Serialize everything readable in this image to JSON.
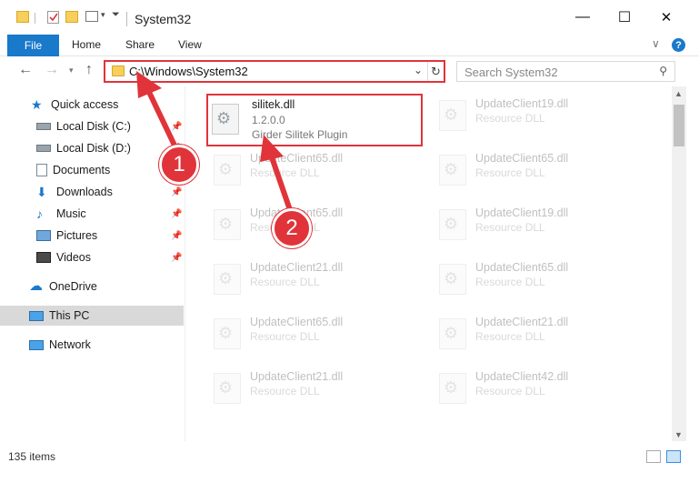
{
  "window": {
    "title": "System32",
    "minimize": "—",
    "maximize": "☐",
    "close": "✕"
  },
  "ribbon": {
    "file_tab": "File",
    "tabs": [
      "Home",
      "Share",
      "View"
    ],
    "help": "?",
    "expand": "∨"
  },
  "address": {
    "path": "C:\\Windows\\System32",
    "search_placeholder": "Search System32"
  },
  "sidebar": {
    "items": [
      {
        "label": "Quick access",
        "icon": "star-icon",
        "pinned": false
      },
      {
        "label": "Local Disk (C:)",
        "icon": "drive-icon",
        "pinned": true
      },
      {
        "label": "Local Disk (D:)",
        "icon": "drive-icon",
        "pinned": true
      },
      {
        "label": "Documents",
        "icon": "documents-icon",
        "pinned": true
      },
      {
        "label": "Downloads",
        "icon": "download-icon",
        "pinned": true
      },
      {
        "label": "Music",
        "icon": "music-icon",
        "pinned": true
      },
      {
        "label": "Pictures",
        "icon": "pictures-icon",
        "pinned": true
      },
      {
        "label": "Videos",
        "icon": "videos-icon",
        "pinned": true
      },
      {
        "label": "OneDrive",
        "icon": "cloud-icon",
        "pinned": false
      },
      {
        "label": "This PC",
        "icon": "computer-icon",
        "pinned": false
      },
      {
        "label": "Network",
        "icon": "network-icon",
        "pinned": false
      }
    ]
  },
  "files": {
    "highlighted": {
      "name": "silitek.dll",
      "version": "1.2.0.0",
      "description": "Girder Silitek Plugin"
    },
    "faded": [
      {
        "name": "UpdateClient19.dll",
        "type": "Resource DLL"
      },
      {
        "name": "UpdateClient65.dll",
        "type": "Resource DLL"
      },
      {
        "name": "UpdateClient65.dll",
        "type": "Resource DLL"
      },
      {
        "name": "UpdateClient65.dll",
        "type": "Resource DLL"
      },
      {
        "name": "UpdateClient19.dll",
        "type": "Resource DLL"
      },
      {
        "name": "UpdateClient21.dll",
        "type": "Resource DLL"
      },
      {
        "name": "UpdateClient65.dll",
        "type": "Resource DLL"
      },
      {
        "name": "UpdateClient65.dll",
        "type": "Resource DLL"
      },
      {
        "name": "UpdateClient21.dll",
        "type": "Resource DLL"
      },
      {
        "name": "UpdateClient21.dll",
        "type": "Resource DLL"
      },
      {
        "name": "UpdateClient42.dll",
        "type": "Resource DLL"
      }
    ]
  },
  "status": {
    "item_count": "135 items"
  },
  "annotations": {
    "step1": "1",
    "step2": "2",
    "accent_color": "#e0343a"
  }
}
